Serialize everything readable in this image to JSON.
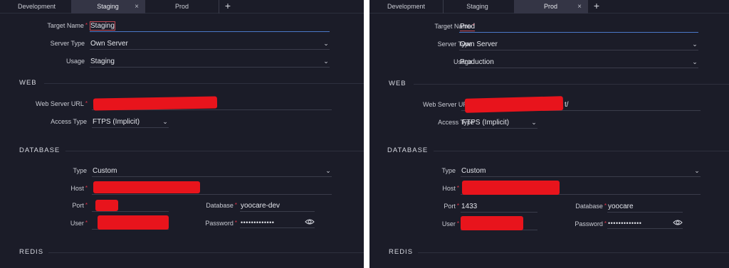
{
  "tabs": [
    "Development",
    "Staging",
    "Prod"
  ],
  "tab_add": "+",
  "tab_close": "×",
  "labels": {
    "target_name": "Target Name",
    "server_type": "Server Type",
    "usage": "Usage",
    "web_server_url": "Web Server URL",
    "access_type": "Access Type",
    "db_type": "Type",
    "host": "Host",
    "port": "Port",
    "database": "Database",
    "user": "User",
    "password": "Password"
  },
  "sections": {
    "web": "WEB",
    "database": "DATABASE",
    "redis": "REDIS"
  },
  "required_mark": "*",
  "chevron": "⌄",
  "left": {
    "active_tab": "Staging",
    "target_name": "Staging",
    "server_type": "Own Server",
    "usage": "Staging",
    "access_type": "FTPS (Implicit)",
    "db_type": "Custom",
    "database": "yoocare-dev",
    "password": "•••••••••••••"
  },
  "right": {
    "active_tab": "Prod",
    "target_name": "Prod",
    "server_type": "Own Server",
    "usage": "Production",
    "web_url_suffix": "t/",
    "access_type": "FTPS (Implicit)",
    "db_type": "Custom",
    "port": "1433",
    "database": "yoocare",
    "password": "•••••••••••••"
  },
  "colors": {
    "background": "#1b1c28",
    "active_tab": "#343545",
    "required": "#e0334a",
    "focus_underline": "#4a78c8",
    "redaction": "#e8141c"
  },
  "icons": {
    "eye": "eye-icon",
    "chevron": "chevron-down-icon",
    "close": "close-icon",
    "plus": "plus-icon"
  }
}
